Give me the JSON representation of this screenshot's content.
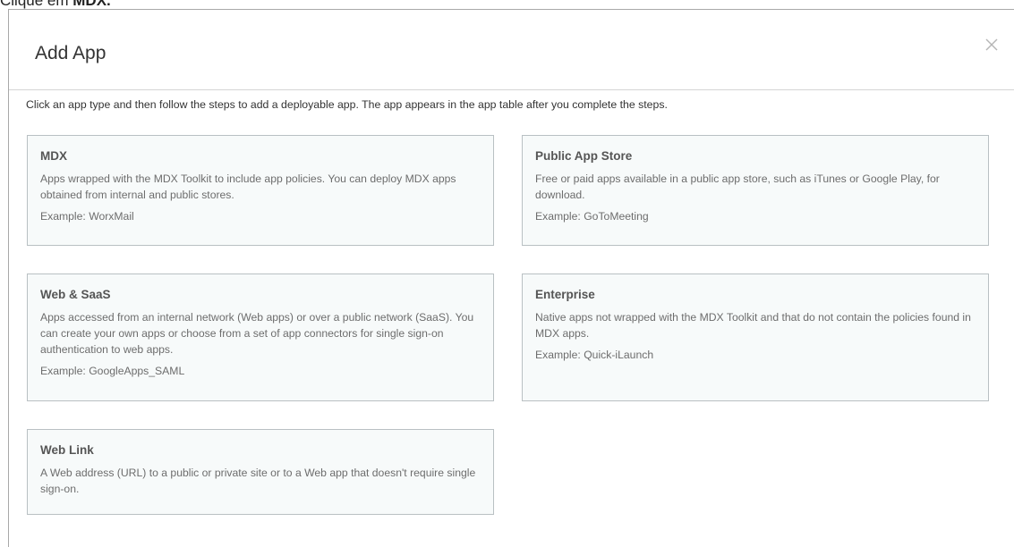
{
  "caption": {
    "prefix": "Clique em ",
    "bold": "MDX."
  },
  "dialog": {
    "title": "Add App",
    "instructions": "Click an app type and then follow the steps to add a deployable app. The app appears in the app table after you complete the steps.",
    "cards": [
      {
        "title": "MDX",
        "description": "Apps wrapped with the MDX Toolkit to include app policies. You can deploy MDX apps obtained from internal and public stores.",
        "example": "Example: WorxMail"
      },
      {
        "title": "Public App Store",
        "description": "Free or paid apps available in a public app store, such as iTunes or Google Play, for download.",
        "example": "Example: GoToMeeting"
      },
      {
        "title": "Web & SaaS",
        "description": "Apps accessed from an internal network (Web apps) or over a public network (SaaS). You can create your own apps or choose from a set of app connectors for single sign-on authentication to web apps.",
        "example": "Example: GoogleApps_SAML"
      },
      {
        "title": "Enterprise",
        "description": "Native apps not wrapped with the MDX Toolkit and that do not contain the policies found in MDX apps.",
        "example": "Example: Quick-iLaunch"
      },
      {
        "title": "Web Link",
        "description": "A Web address (URL) to a public or private site or to a Web app that doesn't require single sign-on.",
        "example": ""
      }
    ]
  },
  "icons": {
    "close": "close-icon"
  },
  "colors": {
    "card_bg": "#f7fafa",
    "card_border": "#b9c0c3",
    "dialog_border": "#a8a8a8"
  }
}
